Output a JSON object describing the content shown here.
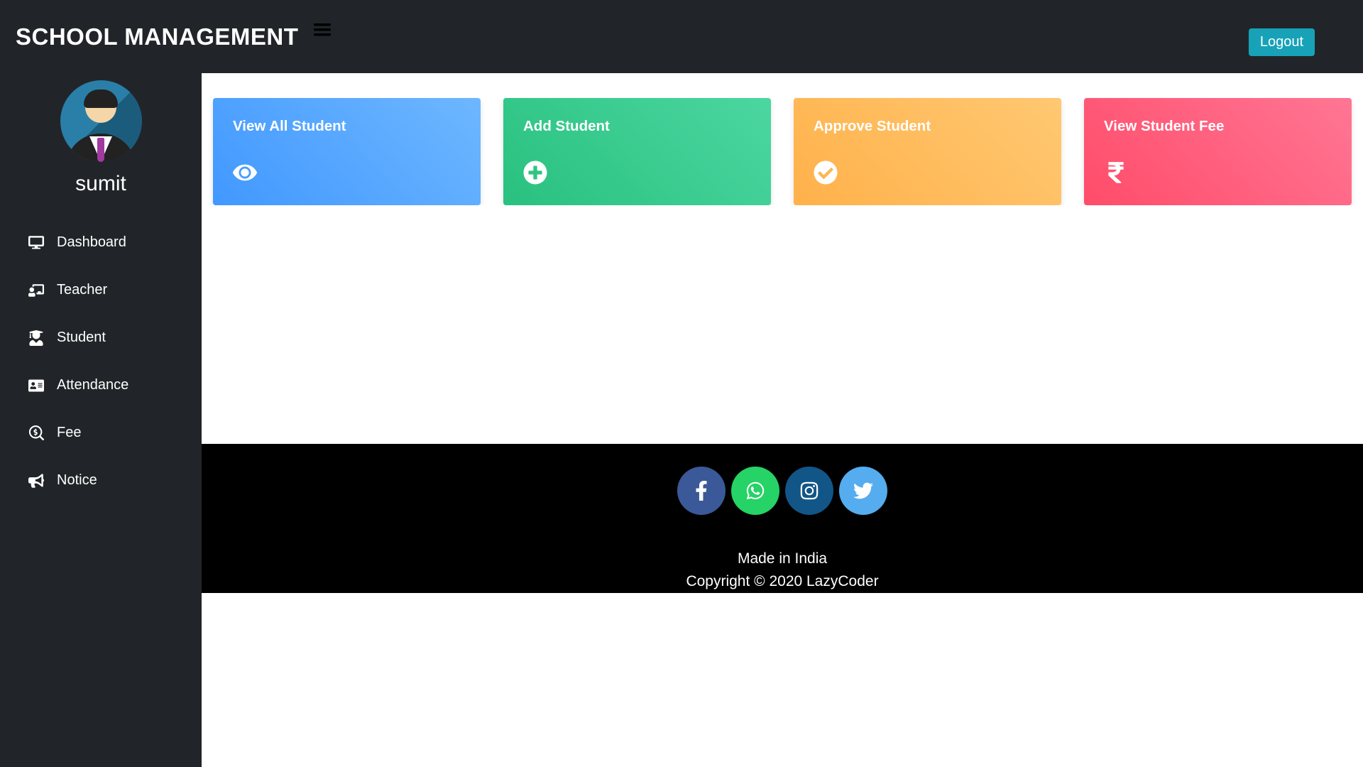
{
  "header": {
    "title": "SCHOOL MANAGEMENT",
    "logout": "Logout"
  },
  "sidebar": {
    "username": "sumit",
    "items": [
      {
        "label": "Dashboard",
        "icon": "desktop"
      },
      {
        "label": "Teacher",
        "icon": "chalkboard"
      },
      {
        "label": "Student",
        "icon": "graduate"
      },
      {
        "label": "Attendance",
        "icon": "id-card"
      },
      {
        "label": "Fee",
        "icon": "search-dollar"
      },
      {
        "label": "Notice",
        "icon": "bullhorn"
      }
    ]
  },
  "cards": [
    {
      "title": "View All Student",
      "icon": "eye",
      "color": "blue"
    },
    {
      "title": "Add Student",
      "icon": "plus",
      "color": "green"
    },
    {
      "title": "Approve Student",
      "icon": "check",
      "color": "yellow"
    },
    {
      "title": "View Student Fee",
      "icon": "rupee",
      "color": "red"
    }
  ],
  "footer": {
    "line1": "Made in India",
    "line2": "Copyright © 2020 LazyCoder",
    "socials": [
      {
        "name": "facebook"
      },
      {
        "name": "whatsapp"
      },
      {
        "name": "instagram"
      },
      {
        "name": "twitter"
      }
    ]
  }
}
